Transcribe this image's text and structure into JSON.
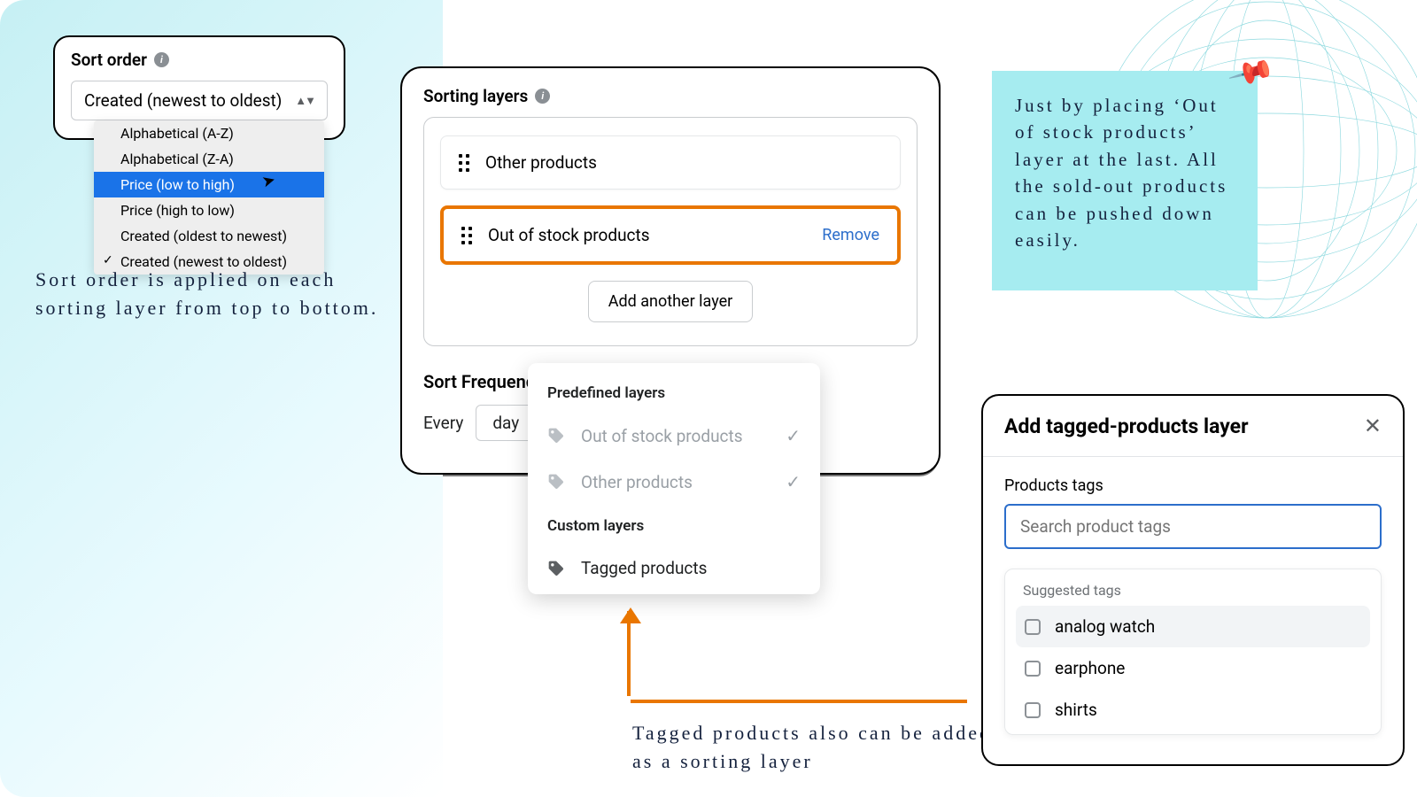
{
  "colors": {
    "accent_orange": "#e97600",
    "link_blue": "#2c6ecb",
    "sticky_bg": "#a6ecf0"
  },
  "sort_order": {
    "label": "Sort order",
    "selected": "Created (newest to oldest)",
    "options": [
      "Alphabetical (A-Z)",
      "Alphabetical (Z-A)",
      "Price (low to high)",
      "Price (high to low)",
      "Created (oldest to newest)",
      "Created (newest to oldest)"
    ],
    "highlighted_index": 2,
    "checked_index": 5
  },
  "caption_sort": "Sort order is applied on each sorting layer from top to bottom.",
  "sorting_layers": {
    "title": "Sorting layers",
    "rows": [
      {
        "label": "Other products",
        "removable": false
      },
      {
        "label": "Out of stock products",
        "removable": true
      }
    ],
    "remove_label": "Remove",
    "add_button": "Add another layer"
  },
  "layers_menu": {
    "predefined_header": "Predefined layers",
    "predefined": [
      {
        "label": "Out of stock products",
        "checked": true
      },
      {
        "label": "Other products",
        "checked": true
      }
    ],
    "custom_header": "Custom layers",
    "custom": [
      {
        "label": "Tagged products"
      }
    ]
  },
  "sort_frequency": {
    "label": "Sort Frequency",
    "prefix": "Every",
    "value": "day"
  },
  "caption_tagged": "Tagged products also can be added as a sorting layer",
  "sticky_note": "Just by placing ‘Out of stock products’ layer at the last. All the sold-out products can be pushed down easily.",
  "tagged_modal": {
    "title": "Add tagged-products layer",
    "products_tags_label": "Products tags",
    "search_placeholder": "Search product tags",
    "suggested_header": "Suggested tags",
    "suggested": [
      "analog watch",
      "earphone",
      "shirts"
    ]
  }
}
